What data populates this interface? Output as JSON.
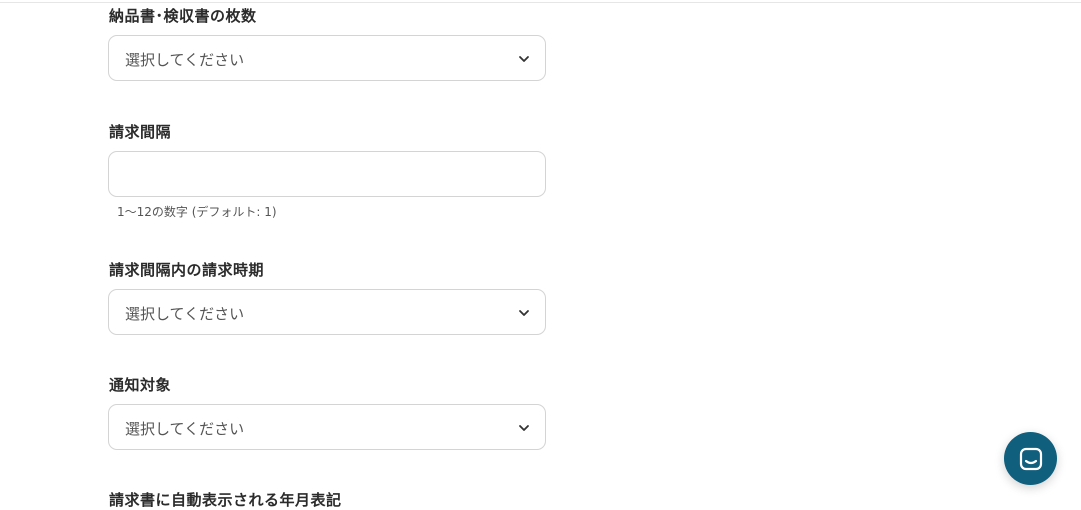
{
  "form": {
    "delivery_count": {
      "label": "納品書･検収書の枚数",
      "placeholder": "選択してください"
    },
    "billing_interval": {
      "label": "請求間隔",
      "value": "",
      "hint": "1〜12の数字 (デフォルト: 1)"
    },
    "billing_timing": {
      "label": "請求間隔内の請求時期",
      "placeholder": "選択してください"
    },
    "notify_target": {
      "label": "通知対象",
      "placeholder": "選択してください"
    },
    "invoice_date_format": {
      "label": "請求書に自動表示される年月表記"
    }
  },
  "icons": {
    "select_chevron": "chevron-down-icon",
    "chat_launcher": "chat-icon"
  },
  "colors": {
    "chat_button": "#0f5f7d",
    "border": "#d4d4d4"
  }
}
